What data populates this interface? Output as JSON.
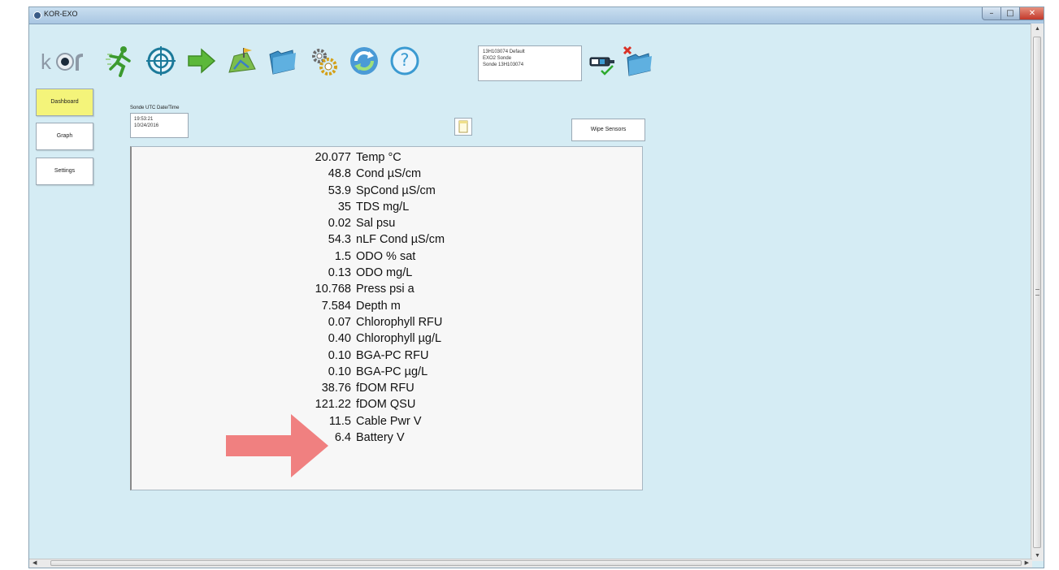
{
  "window": {
    "title": "KOR-EXO",
    "minimize": "–",
    "maximize": "□",
    "close": "✕"
  },
  "toolbar": {
    "icons": [
      "kor-logo",
      "run-icon",
      "calibrate-icon",
      "arrow-right-icon",
      "deploy-icon",
      "folder-icon",
      "gears-icon",
      "sync-icon",
      "help-icon",
      "sonde-connect-icon",
      "disconnect-folder-icon"
    ],
    "help_label": "?"
  },
  "sonde": {
    "line1": "13H103074    Default",
    "line2": "EXO2 Sonde",
    "line3": "Sonde 13H103074"
  },
  "nav": {
    "dashboard": "Dashboard",
    "graph": "Graph",
    "settings": "Settings",
    "active": "Dashboard"
  },
  "datetime": {
    "label": "Sonde UTC Date/Time",
    "time": "19:53:21",
    "date": "10/24/2016"
  },
  "actions": {
    "wipe": "Wipe Sensors"
  },
  "readings": [
    {
      "value": "20.077",
      "unit": "Temp °C"
    },
    {
      "value": "48.8",
      "unit": "Cond µS/cm"
    },
    {
      "value": "53.9",
      "unit": "SpCond µS/cm"
    },
    {
      "value": "35",
      "unit": "TDS mg/L"
    },
    {
      "value": "0.02",
      "unit": "Sal psu"
    },
    {
      "value": "54.3",
      "unit": "nLF Cond µS/cm"
    },
    {
      "value": "1.5",
      "unit": "ODO % sat"
    },
    {
      "value": "0.13",
      "unit": "ODO mg/L"
    },
    {
      "value": "10.768",
      "unit": "Press psi a"
    },
    {
      "value": "7.584",
      "unit": "Depth m"
    },
    {
      "value": "0.07",
      "unit": "Chlorophyll RFU"
    },
    {
      "value": "0.40",
      "unit": "Chlorophyll µg/L"
    },
    {
      "value": "0.10",
      "unit": "BGA-PC RFU"
    },
    {
      "value": "0.10",
      "unit": "BGA-PC µg/L"
    },
    {
      "value": "38.76",
      "unit": "fDOM RFU"
    },
    {
      "value": "121.22",
      "unit": "fDOM QSU"
    },
    {
      "value": "11.5",
      "unit": "Cable Pwr V"
    },
    {
      "value": "6.4",
      "unit": "Battery V"
    }
  ],
  "colors": {
    "background": "#d5ecf4",
    "active_nav": "#f4f47a",
    "pointer_arrow": "#f08080"
  }
}
